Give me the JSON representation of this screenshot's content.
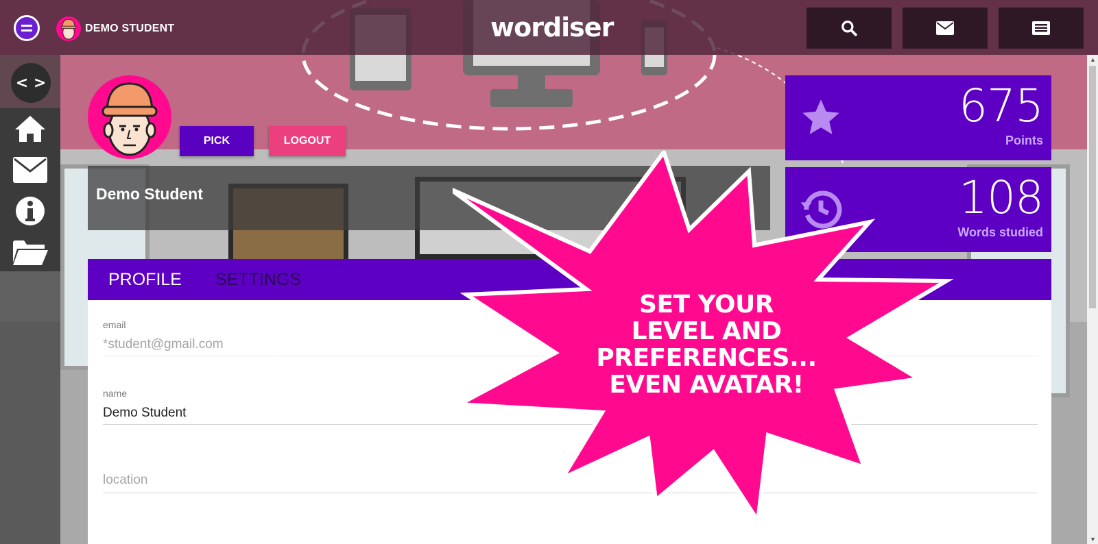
{
  "topbar": {
    "user_name": "DEMO STUDENT",
    "logo": "wordiser",
    "actions": [
      "search-icon",
      "mail-icon",
      "list-icon"
    ]
  },
  "sidenav": {
    "toggle": "< >",
    "items": [
      "home-icon",
      "mail-icon",
      "info-icon",
      "folder-icon"
    ]
  },
  "profile": {
    "pick_label": "PICK",
    "logout_label": "LOGOUT",
    "display_name": "Demo Student"
  },
  "stats": [
    {
      "value": "675",
      "label": "Points",
      "icon": "star-icon"
    },
    {
      "value": "108",
      "label": "Words studied",
      "icon": "history-icon"
    }
  ],
  "tabs": [
    {
      "label": "PROFILE",
      "active": true
    },
    {
      "label": "SETTINGS",
      "active": false
    }
  ],
  "form": {
    "email": {
      "label": "email",
      "value": "*student@gmail.com"
    },
    "name": {
      "label": "name",
      "value": "Demo Student"
    },
    "location": {
      "placeholder": "location"
    }
  },
  "promo": {
    "lines": [
      "SET YOUR",
      "LEVEL AND",
      "PREFERENCES...",
      "EVEN AVATAR!"
    ]
  },
  "colors": {
    "accent_purple": "#5d00c4",
    "promo_pink": "#ff0a8f",
    "logout_pink": "#ec3f7e",
    "topbar": "#4e243a"
  }
}
